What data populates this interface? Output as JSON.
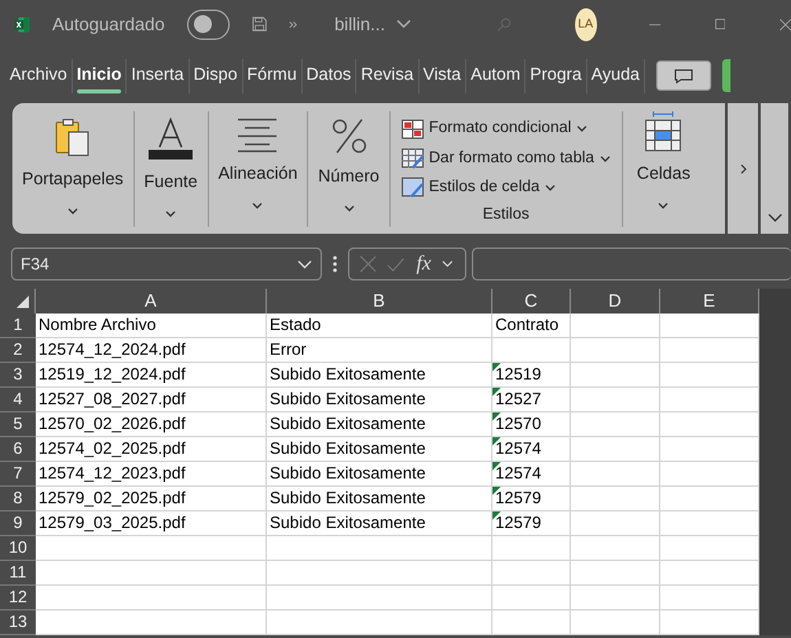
{
  "title_bar": {
    "autosave_label": "Autoguardado",
    "autosave_on": false,
    "filename": "billin...",
    "avatar": "LA"
  },
  "tabs": [
    {
      "label": "Archivo",
      "selected": false
    },
    {
      "label": "Inicio",
      "selected": true
    },
    {
      "label": "Inserta",
      "selected": false
    },
    {
      "label": "Dispo",
      "selected": false
    },
    {
      "label": "Fórmu",
      "selected": false
    },
    {
      "label": "Datos",
      "selected": false
    },
    {
      "label": "Revisa",
      "selected": false
    },
    {
      "label": "Vista",
      "selected": false
    },
    {
      "label": "Autom",
      "selected": false
    },
    {
      "label": "Progra",
      "selected": false
    },
    {
      "label": "Ayuda",
      "selected": false
    }
  ],
  "ribbon": {
    "groups": [
      {
        "kind": "clipboard",
        "label": "Portapapeles"
      },
      {
        "kind": "font",
        "label": "Fuente"
      },
      {
        "kind": "align",
        "label": "Alineación"
      },
      {
        "kind": "number",
        "label": "Número"
      }
    ],
    "styles": {
      "items": [
        {
          "kind": "conditional",
          "label": "Formato condicional"
        },
        {
          "kind": "table",
          "label": "Dar formato como tabla"
        },
        {
          "kind": "cellstyle",
          "label": "Estilos de celda"
        }
      ],
      "label": "Estilos"
    },
    "cells_group": {
      "label": "Celdas"
    }
  },
  "formula_bar": {
    "name_box": "F34",
    "fx": "fx"
  },
  "sheet": {
    "columns": [
      "A",
      "B",
      "C",
      "D",
      "E"
    ],
    "row_numbers": [
      "1",
      "2",
      "3",
      "4",
      "5",
      "6",
      "7",
      "8",
      "9",
      "10",
      "11",
      "12",
      "13"
    ],
    "rows": [
      {
        "a": "Nombre Archivo",
        "b": "Estado",
        "c": "Contrato",
        "c_flagged": false
      },
      {
        "a": "12574_12_2024.pdf",
        "b": "Error",
        "c_flagged": false
      },
      {
        "a": "12519_12_2024.pdf",
        "b": "Subido Exitosamente",
        "c": "12519",
        "c_flagged": true
      },
      {
        "a": "12527_08_2027.pdf",
        "b": "Subido Exitosamente",
        "c": "12527",
        "c_flagged": true
      },
      {
        "a": "12570_02_2026.pdf",
        "b": "Subido Exitosamente",
        "c": "12570",
        "c_flagged": true
      },
      {
        "a": "12574_02_2025.pdf",
        "b": "Subido Exitosamente",
        "c": "12574",
        "c_flagged": true
      },
      {
        "a": "12574_12_2023.pdf",
        "b": "Subido Exitosamente",
        "c": "12574",
        "c_flagged": true
      },
      {
        "a": "12579_02_2025.pdf",
        "b": "Subido Exitosamente",
        "c": "12579",
        "c_flagged": true
      },
      {
        "a": "12579_03_2025.pdf",
        "b": "Subido Exitosamente",
        "c": "12579",
        "c_flagged": true
      }
    ]
  }
}
